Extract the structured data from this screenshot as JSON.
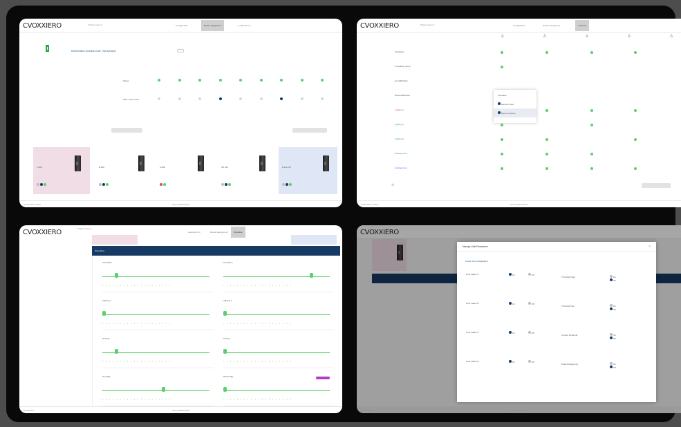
{
  "brand": "CVOXXIERO",
  "colors": {
    "accent": "#163a63",
    "on": "#5bd06a",
    "pink": "#f1dde6",
    "blue": "#dfe7f6",
    "teal": "#2a8b84"
  },
  "screens": [
    {
      "breadcrumb": "Project name",
      "tabs": [
        "Configuration",
        "Device assignment",
        "Load test run"
      ],
      "active_tab": 1,
      "title": "Delete/restore schedule mode · Edit schedule",
      "matrix_rows": [
        "Status",
        "Start / end / timer"
      ],
      "devices": [
        "L-900",
        "B-900",
        "S-900",
        "Off 120",
        "R-Fan 90"
      ],
      "footer_left": "Connected · online",
      "footer_center": "Time synchronised",
      "icon": "device-icon"
    },
    {
      "breadcrumb": "Project name",
      "tabs": [
        "Configuration",
        "Device assignment",
        "Load test"
      ],
      "active_tab": 2,
      "rows": [
        "Ventilation",
        "Circulation pump",
        "Humidification",
        "Dehumidification",
        "Lighting 1",
        "Lighting 2",
        "Lighting 3",
        "Heating zone",
        "Cooling zone"
      ],
      "context_menu": [
        "Schedule",
        "Manual mode",
        "Remove device"
      ],
      "footer_left": "Connected · online",
      "footer_center": "Time synchronised"
    },
    {
      "breadcrumb": "Project name",
      "tabs": [
        "Load test run",
        "Device assignment",
        "Schedule"
      ],
      "active_tab": 2,
      "header": "Schedules",
      "sliders": [
        "Ventilation",
        "Circulation",
        "Lighting 1",
        "Lighting 2",
        "Heating",
        "Cooling",
        "Humidify",
        "Dehumidify"
      ],
      "footer_left": "Connected",
      "footer_center": "Time synchronised"
    },
    {
      "modal_title": "Manage Limit Parameters",
      "modal_subtitle": "Power limit configuration",
      "left_items": [
        "Limit param A",
        "Limit param B",
        "Limit param C",
        "Limit param D"
      ],
      "right_items": [
        "Threshold high",
        "Threshold low",
        "Current threshold",
        "Peak shaving limit"
      ],
      "option_on": "On",
      "option_off": "Off",
      "footer_left": "Connected",
      "footer_center": "Time synchronised"
    }
  ]
}
